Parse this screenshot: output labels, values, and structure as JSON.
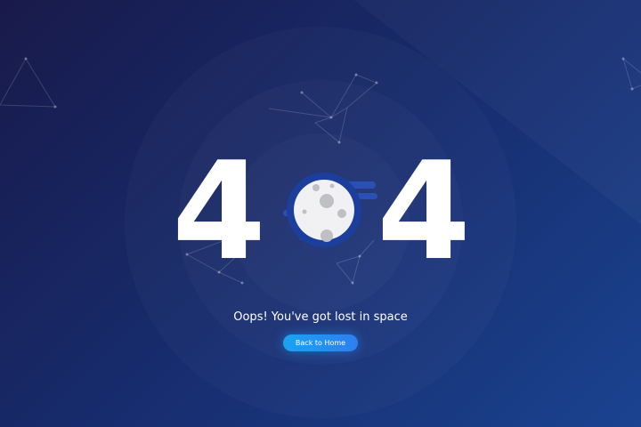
{
  "error": {
    "code_left": "4",
    "code_right": "4",
    "message": "Oops! You've got lost in space"
  },
  "actions": {
    "home_label": "Back to Home"
  },
  "colors": {
    "background_start": "#191a4a",
    "background_end": "#1a4390",
    "moon_fill": "#f1f1f3",
    "moon_crater": "#bfc0c6",
    "moon_trail": "#2b50b5",
    "button_start": "#1aa3f2",
    "button_end": "#2d7ff0"
  },
  "icons": {
    "zero": "moon-icon",
    "decoration": "constellation-icon"
  }
}
